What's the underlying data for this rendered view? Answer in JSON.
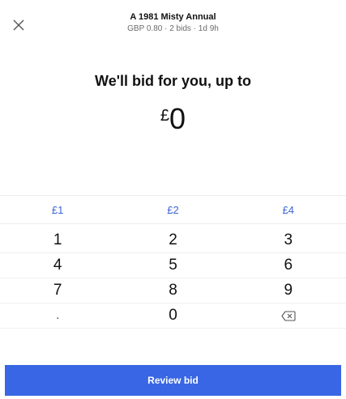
{
  "header": {
    "title": "A 1981 Misty Annual",
    "subtitle": "GBP 0.80 · 2 bids · 1d 9h"
  },
  "prompt": "We'll bid for you, up to",
  "amount": {
    "currency": "£",
    "value": "0"
  },
  "quick_amounts": [
    "£1",
    "£2",
    "£4"
  ],
  "keypad": {
    "keys": [
      "1",
      "2",
      "3",
      "4",
      "5",
      "6",
      "7",
      "8",
      "9",
      ".",
      "0"
    ],
    "backspace_icon": "backspace-icon"
  },
  "review_button": "Review bid",
  "colors": {
    "accent": "#3a63d8",
    "button": "#3866e4"
  }
}
